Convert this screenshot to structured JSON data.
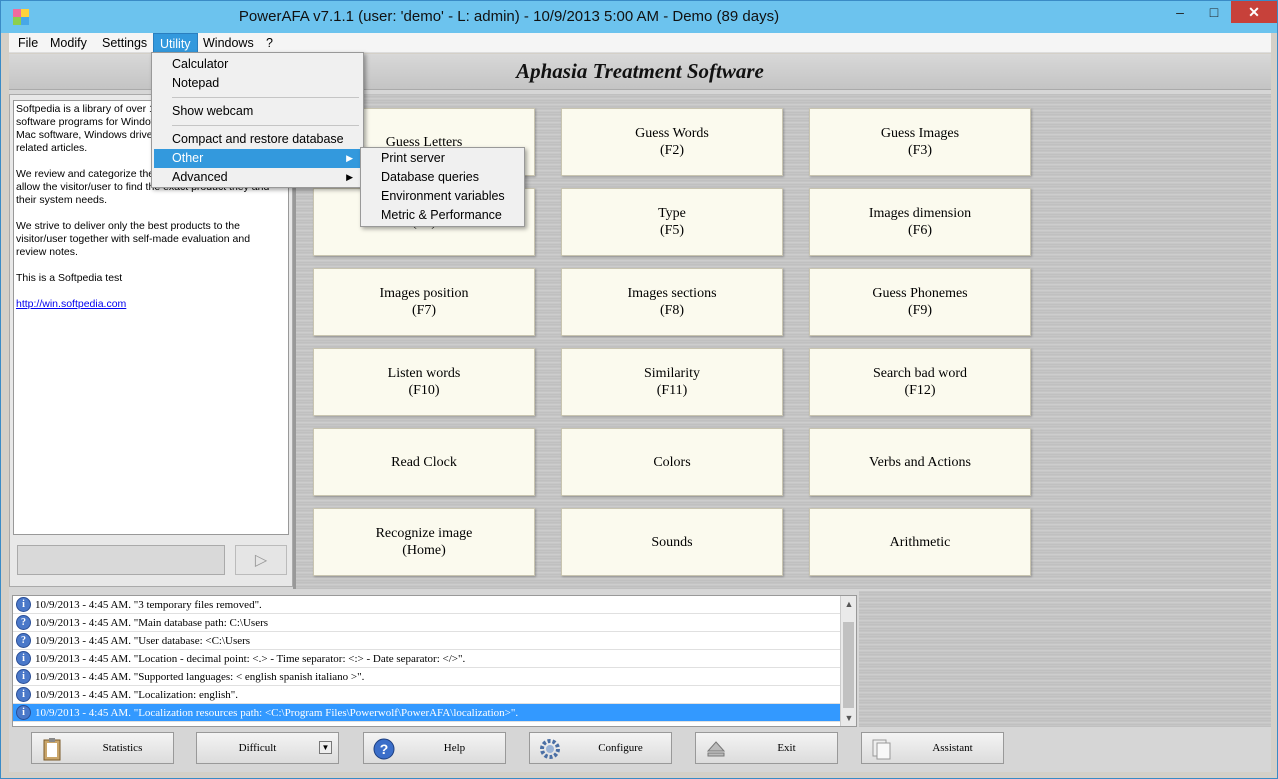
{
  "window": {
    "title": "PowerAFA v7.1.1  (user: 'demo'  - L: admin) - 10/9/2013 5:00 AM - Demo (89 days)",
    "minimize": "–",
    "maximize": "□",
    "close": "✕"
  },
  "menubar": [
    "File",
    "Modify",
    "Settings",
    "Utility",
    "Windows",
    "?"
  ],
  "banner": "Aphasia Treatment Software",
  "utility_menu": {
    "items": [
      "Calculator",
      "Notepad",
      "Show webcam",
      "Compact and restore database",
      "Other",
      "Advanced"
    ]
  },
  "other_submenu": [
    "Print server",
    "Database queries",
    "Environment variables",
    "Metric & Performance"
  ],
  "notes": {
    "p1": "Softpedia is a library of over 1",
    "p1b": "software programs for Window",
    "p1c": "Mac software, Windows drive",
    "p1d": "related articles.",
    "p2": "We review and categorize the",
    "p2b": "allow the visitor/user to find the exact product they and",
    "p2c": "their system needs.",
    "p3": "We strive to deliver only the best products to the visitor/user together with self-made evaluation and review notes.",
    "p4": "This is a Softpedia test",
    "link": "http://win.softpedia.com"
  },
  "tiles": [
    {
      "name": "Guess Letters",
      "key": ""
    },
    {
      "name": "Guess Words",
      "key": "(F2)"
    },
    {
      "name": "Guess Images",
      "key": "(F3)"
    },
    {
      "name": "",
      "key": "(F4)"
    },
    {
      "name": "Type",
      "key": "(F5)"
    },
    {
      "name": "Images dimension",
      "key": "(F6)"
    },
    {
      "name": "Images position",
      "key": "(F7)"
    },
    {
      "name": "Images sections",
      "key": "(F8)"
    },
    {
      "name": "Guess Phonemes",
      "key": "(F9)"
    },
    {
      "name": "Listen words",
      "key": "(F10)"
    },
    {
      "name": "Similarity",
      "key": "(F11)"
    },
    {
      "name": "Search bad word",
      "key": "(F12)"
    },
    {
      "name": "Read Clock",
      "key": ""
    },
    {
      "name": "Colors",
      "key": ""
    },
    {
      "name": "Verbs and Actions",
      "key": ""
    },
    {
      "name": "Recognize image",
      "key": "(Home)"
    },
    {
      "name": "Sounds",
      "key": ""
    },
    {
      "name": "Arithmetic",
      "key": ""
    }
  ],
  "log": [
    {
      "icon": "i",
      "text": "10/9/2013 - 4:45 AM. \"3 temporary files removed\"."
    },
    {
      "icon": "?",
      "text": "10/9/2013 - 4:45 AM. \"Main database path: C:\\Users"
    },
    {
      "icon": "?",
      "text": "10/9/2013 - 4:45 AM. \"User database: <C:\\Users"
    },
    {
      "icon": "i",
      "text": "10/9/2013 - 4:45 AM. \"Location - decimal point: <.> - Time separator: <:> - Date separator: </>\"."
    },
    {
      "icon": "i",
      "text": "10/9/2013 - 4:45 AM. \"Supported languages: < english spanish italiano >\"."
    },
    {
      "icon": "i",
      "text": "10/9/2013 - 4:45 AM. \"Localization: english\"."
    },
    {
      "icon": "i",
      "text": "10/9/2013 - 4:45 AM. \"Localization resources path: <C:\\Program Files\\Powerwolf\\PowerAFA\\localization>\"."
    }
  ],
  "bottom": {
    "statistics": "Statistics",
    "difficulty": "Difficult",
    "help": "Help",
    "configure": "Configure",
    "exit": "Exit",
    "assistant": "Assistant"
  }
}
